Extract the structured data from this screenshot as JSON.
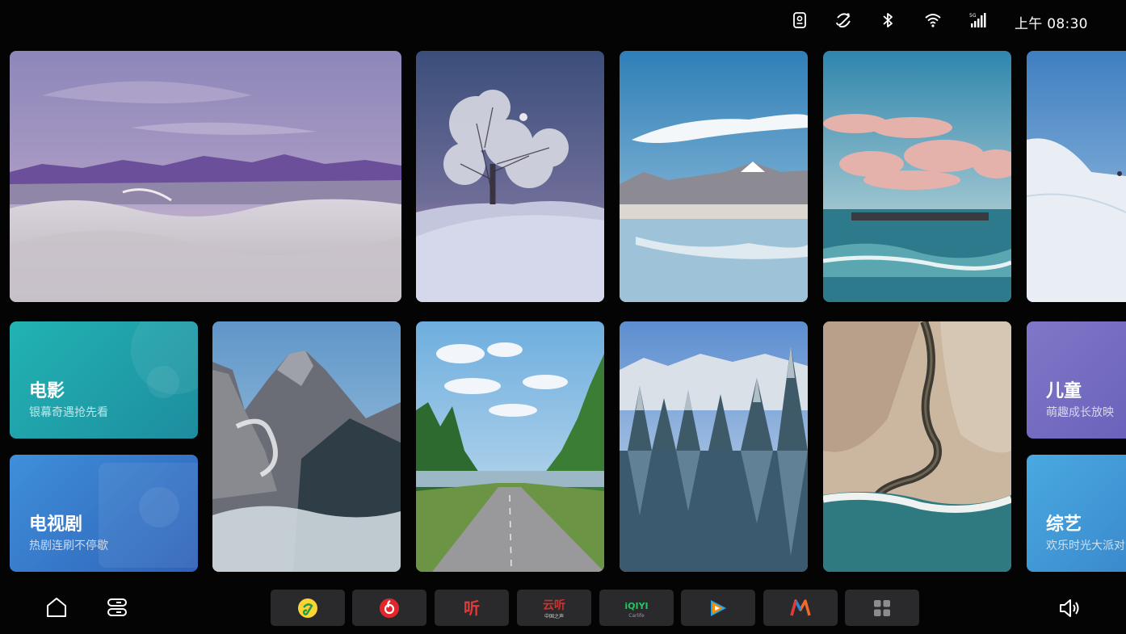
{
  "status_bar": {
    "icons": [
      "assistant-icon",
      "cast-icon",
      "bluetooth-icon",
      "wifi-icon",
      "signal-icon"
    ],
    "time": "上午 08:30"
  },
  "photo_tiles": [
    {
      "scene": "desert-dunes"
    },
    {
      "scene": "snowy-tree-moon"
    },
    {
      "scene": "lake-reflection"
    },
    {
      "scene": "sea-clouds"
    },
    {
      "scene": "snow-slope"
    },
    {
      "scene": "mountain-peaks"
    },
    {
      "scene": "forest-road"
    },
    {
      "scene": "snowy-forest-lake"
    },
    {
      "scene": "aerial-river"
    }
  ],
  "categories": {
    "movie": {
      "title": "电影",
      "subtitle": "银幕奇遇抢先看",
      "color": "#1fa6a9"
    },
    "tv": {
      "title": "电视剧",
      "subtitle": "热剧连刷不停歇",
      "color": "#2f6fc0"
    },
    "kids": {
      "title": "儿童",
      "subtitle": "萌趣成长放映",
      "color": "#7668c0"
    },
    "variety": {
      "title": "综艺",
      "subtitle": "欢乐时光大派对",
      "color": "#3d98d4"
    }
  },
  "dock": {
    "left_icons": [
      "home-icon",
      "storage-icon"
    ],
    "apps": [
      {
        "name": "qq-music-icon"
      },
      {
        "name": "netease-music-icon"
      },
      {
        "name": "ting-audio-icon",
        "label": "听"
      },
      {
        "name": "yunting-radio-icon",
        "label": "云听",
        "sublabel": "中国之声"
      },
      {
        "name": "iqiyi-icon",
        "label": "iQIYI",
        "sublabel": "Carlife"
      },
      {
        "name": "tencent-video-icon"
      },
      {
        "name": "mango-tv-icon"
      },
      {
        "name": "all-apps-icon"
      }
    ],
    "right_icon": "volume-icon"
  }
}
